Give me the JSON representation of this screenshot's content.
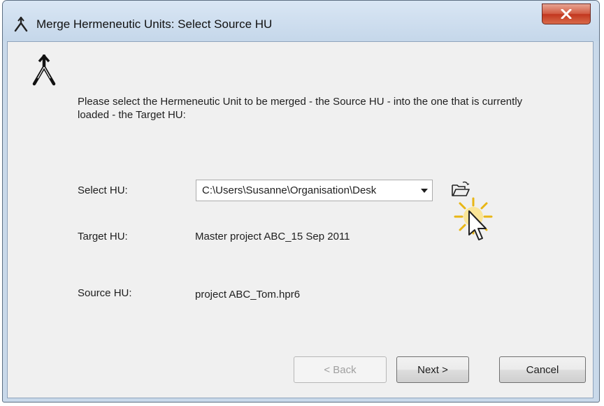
{
  "window": {
    "title": "Merge Hermeneutic Units: Select Source HU",
    "title_icon": "merge-icon",
    "close_icon": "close-icon"
  },
  "intro": {
    "text": "Please select the Hermeneutic Unit to be merged - the Source HU - into the one that is currently loaded - the Target HU:",
    "icon": "merge-icon"
  },
  "form": {
    "select_hu": {
      "label": "Select HU:",
      "value": "C:\\Users\\Susanne\\Organisation\\Desk",
      "browse_icon": "folder-open-icon"
    },
    "target_hu": {
      "label": "Target HU:",
      "value": "Master project ABC_15 Sep 2011"
    },
    "source_hu": {
      "label": "Source HU:",
      "value": "project ABC_Tom.hpr6"
    }
  },
  "buttons": {
    "back": "< Back",
    "next": "Next >",
    "cancel": "Cancel"
  },
  "colors": {
    "titlebar": "#c9d9ea",
    "client": "#f0f0f0",
    "close_button": "#c94a31",
    "cursor_highlight": "#f0c419"
  }
}
